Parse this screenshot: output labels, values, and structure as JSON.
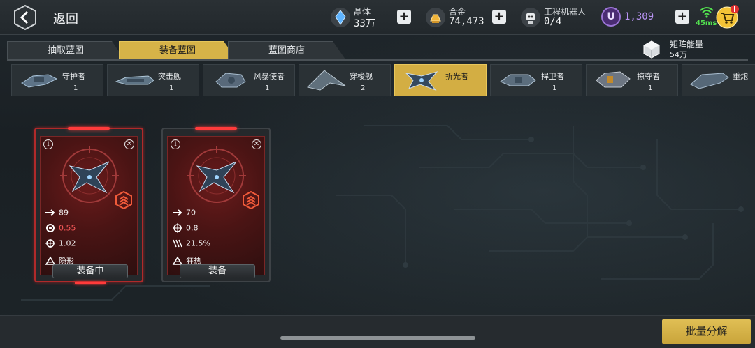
{
  "header": {
    "back_label": "返回",
    "resources": [
      {
        "name": "crystal",
        "label": "晶体",
        "value": "33万",
        "icon": "crystal-icon"
      },
      {
        "name": "alloy",
        "label": "合金",
        "value": "74,473",
        "icon": "alloy-icon"
      },
      {
        "name": "robot",
        "label": "工程机器人",
        "value": "0/4",
        "icon": "robot-icon"
      }
    ],
    "currency_u": {
      "symbol": "U",
      "value": "1,309"
    },
    "ping": "45ms"
  },
  "tabs": [
    {
      "label": "抽取蓝图",
      "active": false
    },
    {
      "label": "装备蓝图",
      "active": true
    },
    {
      "label": "蓝图商店",
      "active": false
    }
  ],
  "matrix_energy": {
    "label": "矩阵能量",
    "value": "54万"
  },
  "categories": [
    {
      "name": "守护者",
      "count": "1",
      "active": false
    },
    {
      "name": "突击舰",
      "count": "1",
      "active": false
    },
    {
      "name": "风暴使者",
      "count": "1",
      "active": false
    },
    {
      "name": "穿梭舰",
      "count": "2",
      "active": false
    },
    {
      "name": "折光者",
      "count": "",
      "active": true
    },
    {
      "name": "捍卫者",
      "count": "1",
      "active": false
    },
    {
      "name": "掠夺者",
      "count": "1",
      "active": false
    },
    {
      "name": "重炮",
      "count": "",
      "active": false
    }
  ],
  "cards": [
    {
      "stats": [
        {
          "icon": "speed-arrow-icon",
          "value": "89",
          "red": false
        },
        {
          "icon": "gear-cog-icon",
          "value": "0.55",
          "red": true
        },
        {
          "icon": "crosshair-icon",
          "value": "1.02",
          "red": false
        },
        {
          "icon": "stealth-icon",
          "value": "隐形",
          "red": false
        }
      ],
      "button": "装备中",
      "equipped": true
    },
    {
      "stats": [
        {
          "icon": "speed-arrow-icon",
          "value": "70",
          "red": false
        },
        {
          "icon": "crosshair-icon",
          "value": "0.8",
          "red": false
        },
        {
          "icon": "claw-icon",
          "value": "21.5%",
          "red": false
        },
        {
          "icon": "frenzy-icon",
          "value": "狂热",
          "red": false
        }
      ],
      "button": "装备",
      "equipped": false
    }
  ],
  "bulk_button": "批量分解",
  "colors": {
    "accent_gold": "#d6b348",
    "equipped_red": "#ff3b3b",
    "currency_purple": "#b793f2",
    "ping_green": "#52e04f"
  }
}
